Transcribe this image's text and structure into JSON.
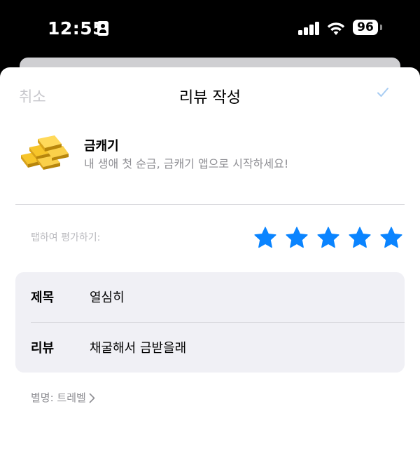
{
  "status_bar": {
    "time": "12:55",
    "battery": "96",
    "icons": [
      "person-icon",
      "cellular-signal-icon",
      "wifi-icon",
      "battery-icon"
    ]
  },
  "nav": {
    "cancel_label": "취소",
    "title": "리뷰 작성",
    "submit_icon": "checkmark-icon"
  },
  "app": {
    "icon": "gold-bars-icon",
    "name": "금캐기",
    "subtitle": "내 생애 첫 순금, 금캐기 앱으로 시작하세요!"
  },
  "rating": {
    "label": "탭하여 평가하기:",
    "value": 5,
    "max": 5,
    "star_color": "#0a84ff"
  },
  "form": {
    "title_label": "제목",
    "title_value": "열심히",
    "review_label": "리뷰",
    "review_value": "채굴해서 금받을래"
  },
  "nickname": {
    "label": "별명: 트레벨"
  },
  "colors": {
    "accent": "#0a84ff",
    "sheet_bg": "#ffffff",
    "card_bg": "#f0f0f5",
    "disabled_text": "#c7c7cc"
  }
}
